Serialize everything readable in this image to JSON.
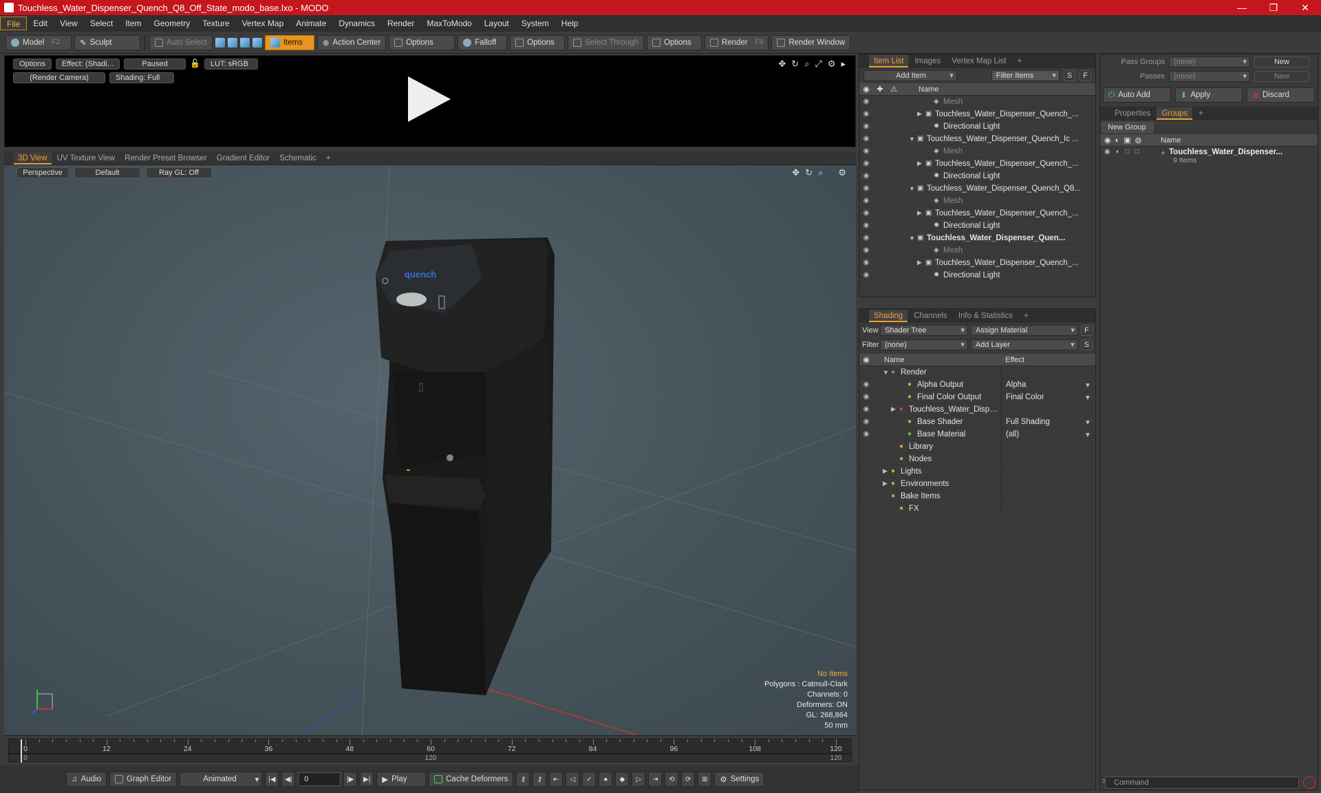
{
  "window": {
    "title": "Touchless_Water_Dispenser_Quench_Q8_Off_State_modo_base.lxo - MODO",
    "minimize": "—",
    "maximize": "❐",
    "close": "✕"
  },
  "menu": [
    "File",
    "Edit",
    "View",
    "Select",
    "Item",
    "Geometry",
    "Texture",
    "Vertex Map",
    "Animate",
    "Dynamics",
    "Render",
    "MaxToModo",
    "Layout",
    "System",
    "Help"
  ],
  "toolbar": {
    "model": "Model",
    "model_key": "F2",
    "sculpt": "Sculpt",
    "auto_select": "Auto Select",
    "items": "Items",
    "action_center": "Action Center",
    "options1": "Options",
    "falloff": "Falloff",
    "options2": "Options",
    "select_through": "Select Through",
    "options3": "Options",
    "render": "Render",
    "render_key": "F9",
    "render_window": "Render Window"
  },
  "preview": {
    "options": "Options",
    "effect": "Effect: (Shadi...",
    "paused": "Paused",
    "lut": "LUT: sRGB",
    "camera": "(Render Camera)",
    "shading": "Shading: Full"
  },
  "viewport": {
    "tabs": [
      "3D View",
      "UV Texture View",
      "Render Preset Browser",
      "Gradient Editor",
      "Schematic",
      "+"
    ],
    "perspective": "Perspective",
    "default": "Default",
    "raygl": "Ray GL: Off",
    "hud": {
      "no_items": "No Items",
      "polygons": "Polygons : Catmull-Clark",
      "channels": "Channels: 0",
      "deformers": "Deformers: ON",
      "gl": "GL: 268,864",
      "scale": "50 mm"
    },
    "logo": "quench"
  },
  "timeline": {
    "labels": [
      "0",
      "12",
      "24",
      "36",
      "48",
      "60",
      "72",
      "84",
      "96",
      "108",
      "120"
    ],
    "sub_labels": [
      "0",
      "120",
      "120"
    ]
  },
  "bottombar": {
    "audio": "Audio",
    "graph_editor": "Graph Editor",
    "animated": "Animated",
    "frame": "0",
    "play": "Play",
    "cache": "Cache Deformers",
    "settings": "Settings"
  },
  "itemlist": {
    "tabs": [
      "Item List",
      "Images",
      "Vertex Map List",
      "+"
    ],
    "add_item": "Add Item",
    "filter_items": "Filter Items",
    "s": "S",
    "f": "F",
    "col_name": "Name",
    "rows": [
      {
        "label": "Mesh",
        "indent": 3,
        "dim": true,
        "arrow": ""
      },
      {
        "label": "Touchless_Water_Dispenser_Quench_...",
        "indent": 2,
        "dim": false,
        "arrow": "▶"
      },
      {
        "label": "Directional Light",
        "indent": 3,
        "dim": false,
        "arrow": ""
      },
      {
        "label": "Touchless_Water_Dispenser_Quench_Ic ...",
        "indent": 1,
        "dim": false,
        "arrow": "▼"
      },
      {
        "label": "Mesh",
        "indent": 3,
        "dim": true,
        "arrow": ""
      },
      {
        "label": "Touchless_Water_Dispenser_Quench_...",
        "indent": 2,
        "dim": false,
        "arrow": "▶"
      },
      {
        "label": "Directional Light",
        "indent": 3,
        "dim": false,
        "arrow": ""
      },
      {
        "label": "Touchless_Water_Dispenser_Quench_Q8...",
        "indent": 1,
        "dim": false,
        "arrow": "▼"
      },
      {
        "label": "Mesh",
        "indent": 3,
        "dim": true,
        "arrow": ""
      },
      {
        "label": "Touchless_Water_Dispenser_Quench_...",
        "indent": 2,
        "dim": false,
        "arrow": "▶"
      },
      {
        "label": "Directional Light",
        "indent": 3,
        "dim": false,
        "arrow": ""
      },
      {
        "label": "Touchless_Water_Dispenser_Quen...",
        "indent": 1,
        "dim": false,
        "arrow": "▼",
        "bold": true
      },
      {
        "label": "Mesh",
        "indent": 3,
        "dim": true,
        "arrow": ""
      },
      {
        "label": "Touchless_Water_Dispenser_Quench_...",
        "indent": 2,
        "dim": false,
        "arrow": "▶"
      },
      {
        "label": "Directional Light",
        "indent": 3,
        "dim": false,
        "arrow": ""
      }
    ]
  },
  "shading": {
    "tabs": [
      "Shading",
      "Channels",
      "Info & Statistics",
      "+"
    ],
    "view_label": "View",
    "view_value": "Shader Tree",
    "assign_material": "Assign Material",
    "filter_label": "Filter",
    "filter_value": "(none)",
    "add_layer": "Add Layer",
    "col_name": "Name",
    "col_effect": "Effect",
    "rows": [
      {
        "label": "Render",
        "effect": "",
        "indent": 0,
        "arrow": "▼",
        "eye": false
      },
      {
        "label": "Alpha Output",
        "effect": "Alpha",
        "indent": 2,
        "arrow": "",
        "eye": true
      },
      {
        "label": "Final Color Output",
        "effect": "Final Color",
        "indent": 2,
        "arrow": "",
        "eye": true
      },
      {
        "label": "Touchless_Water_Dispense...",
        "effect": "",
        "indent": 1,
        "arrow": "▶",
        "eye": true
      },
      {
        "label": "Base Shader",
        "effect": "Full Shading",
        "indent": 2,
        "arrow": "",
        "eye": true
      },
      {
        "label": "Base Material",
        "effect": "(all)",
        "indent": 2,
        "arrow": "",
        "eye": true
      },
      {
        "label": "Library",
        "effect": "",
        "indent": 1,
        "arrow": "",
        "eye": false
      },
      {
        "label": "Nodes",
        "effect": "",
        "indent": 1,
        "arrow": "",
        "eye": false
      },
      {
        "label": "Lights",
        "effect": "",
        "indent": 0,
        "arrow": "▶",
        "eye": false
      },
      {
        "label": "Environments",
        "effect": "",
        "indent": 0,
        "arrow": "▶",
        "eye": false
      },
      {
        "label": "Bake Items",
        "effect": "",
        "indent": 0,
        "arrow": "",
        "eye": false
      },
      {
        "label": "FX",
        "effect": "",
        "indent": 1,
        "arrow": "",
        "eye": false
      }
    ]
  },
  "groups": {
    "pass_groups": "Pass Groups",
    "pass_value": "(none)",
    "new": "New",
    "passes": "Passes",
    "passes_value": "(none)",
    "new2": "New",
    "auto_add": "Auto Add",
    "apply": "Apply",
    "discard": "Discard",
    "tabs": [
      "Properties",
      "Groups",
      "+"
    ],
    "new_group": "New Group",
    "col_name": "Name",
    "item_name": "Touchless_Water_Dispenser...",
    "item_count": "9 Items"
  },
  "command": {
    "placeholder": "Command",
    "prompt": ">"
  }
}
